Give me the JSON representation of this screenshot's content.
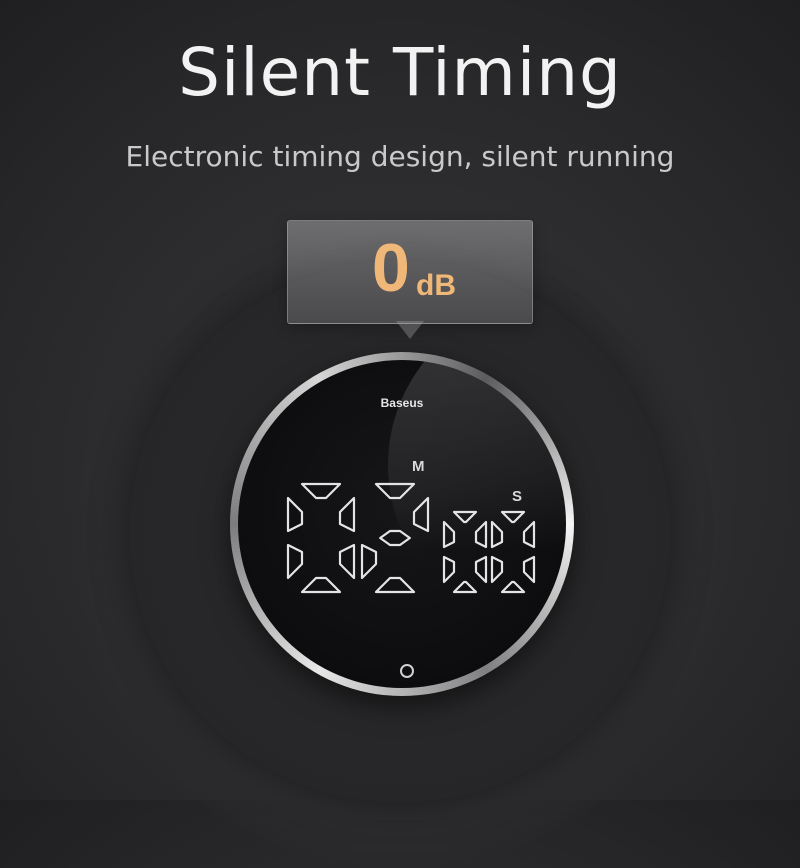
{
  "headline": "Silent Timing",
  "subline": "Electronic timing design, silent running",
  "callout": {
    "value": "0",
    "unit": "dB"
  },
  "timer": {
    "brand": "Baseus",
    "minutes_label": "M",
    "seconds_label": "S",
    "minutes": "02",
    "seconds": "00"
  },
  "colors": {
    "accent": "#f0b878",
    "background": "#2e2e30"
  }
}
